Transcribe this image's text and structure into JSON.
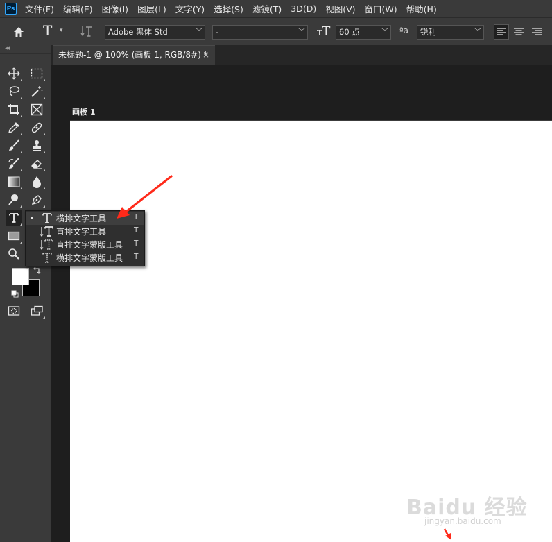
{
  "app": {
    "logo_text": "Ps",
    "accent": "#31a8ff"
  },
  "menubar": {
    "items": [
      "文件(F)",
      "编辑(E)",
      "图像(I)",
      "图层(L)",
      "文字(Y)",
      "选择(S)",
      "滤镜(T)",
      "3D(D)",
      "视图(V)",
      "窗口(W)",
      "帮助(H)"
    ]
  },
  "options": {
    "font_family": "Adobe 黑体 Std",
    "font_style": "-",
    "font_size": "60 点",
    "aa_icon": "ªa",
    "antialias": "锐利"
  },
  "document": {
    "tab_title": "未标题-1 @ 100% (画板 1, RGB/8#) *",
    "close": "×",
    "artboard_label": "画板 1"
  },
  "colors": {
    "foreground": "#ffffff",
    "background": "#000000",
    "annotation": "#ff2a1a"
  },
  "flyout": {
    "items": [
      {
        "label": "横排文字工具",
        "key": "T",
        "icon": "horizontal-type-icon"
      },
      {
        "label": "直排文字工具",
        "key": "T",
        "icon": "vertical-type-icon"
      },
      {
        "label": "直排文字蒙版工具",
        "key": "T",
        "icon": "vertical-type-mask-icon"
      },
      {
        "label": "横排文字蒙版工具",
        "key": "T",
        "icon": "horizontal-type-mask-icon"
      }
    ],
    "selected_index": 0
  },
  "watermark": {
    "logo": "Baidu 经验",
    "url": "jingyan.baidu.com"
  }
}
